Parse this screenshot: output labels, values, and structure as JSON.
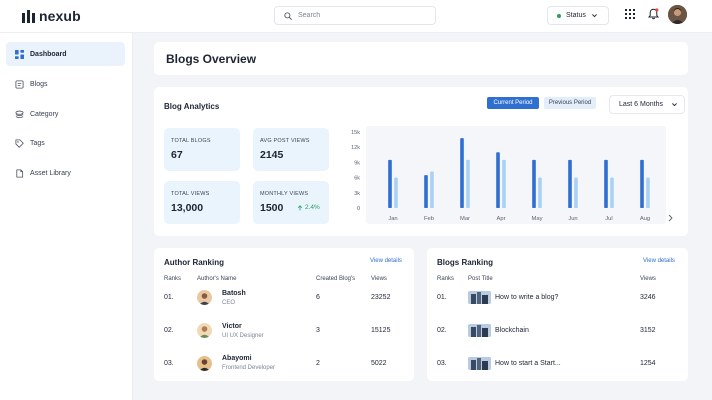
{
  "brand": {
    "name": "nexub"
  },
  "topbar": {
    "search_placeholder": "Search",
    "status_label": "Status",
    "icons": [
      "search-icon",
      "chevron-down-icon",
      "apps-grid-icon",
      "bell-icon",
      "avatar"
    ]
  },
  "sidebar": {
    "items": [
      {
        "label": "Dashboard",
        "icon": "dashboard-icon",
        "active": true
      },
      {
        "label": "Blogs",
        "icon": "blogs-icon",
        "active": false
      },
      {
        "label": "Category",
        "icon": "category-icon",
        "active": false
      },
      {
        "label": "Tags",
        "icon": "tag-icon",
        "active": false
      },
      {
        "label": "Asset Library",
        "icon": "asset-library-icon",
        "active": false
      }
    ]
  },
  "page": {
    "title": "Blogs Overview"
  },
  "analytics": {
    "title": "Blog Analytics",
    "current_period_label": "Current Period",
    "previous_period_label": "Previous Period",
    "range_label": "Last 6 Months",
    "stats": {
      "total_blogs": {
        "label": "TOTAL BLOGS",
        "value": "67"
      },
      "avg_post_views": {
        "label": "AVG POST VIEWS",
        "value": "2145"
      },
      "total_views": {
        "label": "TOTAL VIEWS",
        "value": "13,000"
      },
      "monthly_views": {
        "label": "MONTHLY VIEWS",
        "value": "1500",
        "change": "2.4%"
      }
    }
  },
  "chart_data": {
    "type": "bar",
    "categories": [
      "Jan",
      "Feb",
      "Mar",
      "Apr",
      "May",
      "Jun",
      "Jul",
      "Aug"
    ],
    "y_tick_labels": [
      "15k",
      "12k",
      "9k",
      "6k",
      "3k",
      "0"
    ],
    "ylim": [
      0,
      15000
    ],
    "series": [
      {
        "name": "Current Period",
        "color": "#2f6fd0",
        "values": [
          9500,
          6500,
          13800,
          11000,
          9500,
          9500,
          9500,
          9500
        ]
      },
      {
        "name": "Previous Period",
        "color": "#a9d1f5",
        "values": [
          6000,
          7200,
          9500,
          9500,
          6000,
          6000,
          6000,
          6000
        ]
      }
    ],
    "grid": false,
    "legend": "top-right"
  },
  "author_ranking": {
    "title": "Author Ranking",
    "view_details": "View details",
    "columns": [
      "Ranks",
      "Author's Name",
      "Created Blog's",
      "Views"
    ],
    "rows": [
      {
        "rank": "01.",
        "name": "Batosh",
        "role": "CEO",
        "blogs": "6",
        "views": "23252"
      },
      {
        "rank": "02.",
        "name": "Victor",
        "role": "UI UX Designer",
        "blogs": "3",
        "views": "15125"
      },
      {
        "rank": "03.",
        "name": "Abayomi",
        "role": "Frontend Developer",
        "blogs": "2",
        "views": "5022"
      }
    ]
  },
  "blogs_ranking": {
    "title": "Blogs Ranking",
    "view_details": "View details",
    "columns": [
      "Ranks",
      "Post Title",
      "Views"
    ],
    "rows": [
      {
        "rank": "01.",
        "title": "How to write a blog?",
        "views": "3246"
      },
      {
        "rank": "02.",
        "title": "Blockchain",
        "views": "3152"
      },
      {
        "rank": "03.",
        "title": "How to start a Start...",
        "views": "1254"
      }
    ]
  }
}
